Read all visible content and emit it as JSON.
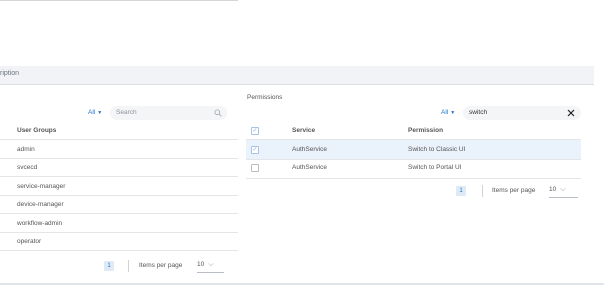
{
  "description_header": "ription",
  "user_groups": {
    "filter": "All",
    "search_placeholder": "Search",
    "column_header": "User Groups",
    "rows": [
      "admin",
      "svcecd",
      "service-manager",
      "device-manager",
      "workflow-admin",
      "operator"
    ],
    "pagination": {
      "page": "1",
      "items_per_page_label": "Items per page",
      "items_per_page": "10"
    }
  },
  "permissions": {
    "title": "Permissions",
    "filter": "All",
    "search_value": "switch",
    "columns": {
      "service": "Service",
      "permission": "Permission"
    },
    "rows": [
      {
        "service": "AuthService",
        "permission": "Switch to Classic UI",
        "selected": true
      },
      {
        "service": "AuthService",
        "permission": "Switch to Portal UI",
        "selected": false
      }
    ],
    "pagination": {
      "page": "1",
      "items_per_page_label": "Items per page",
      "items_per_page": "10"
    }
  },
  "colors": {
    "accent": "#1a73c9",
    "selected_row": "#eaf2fb"
  }
}
